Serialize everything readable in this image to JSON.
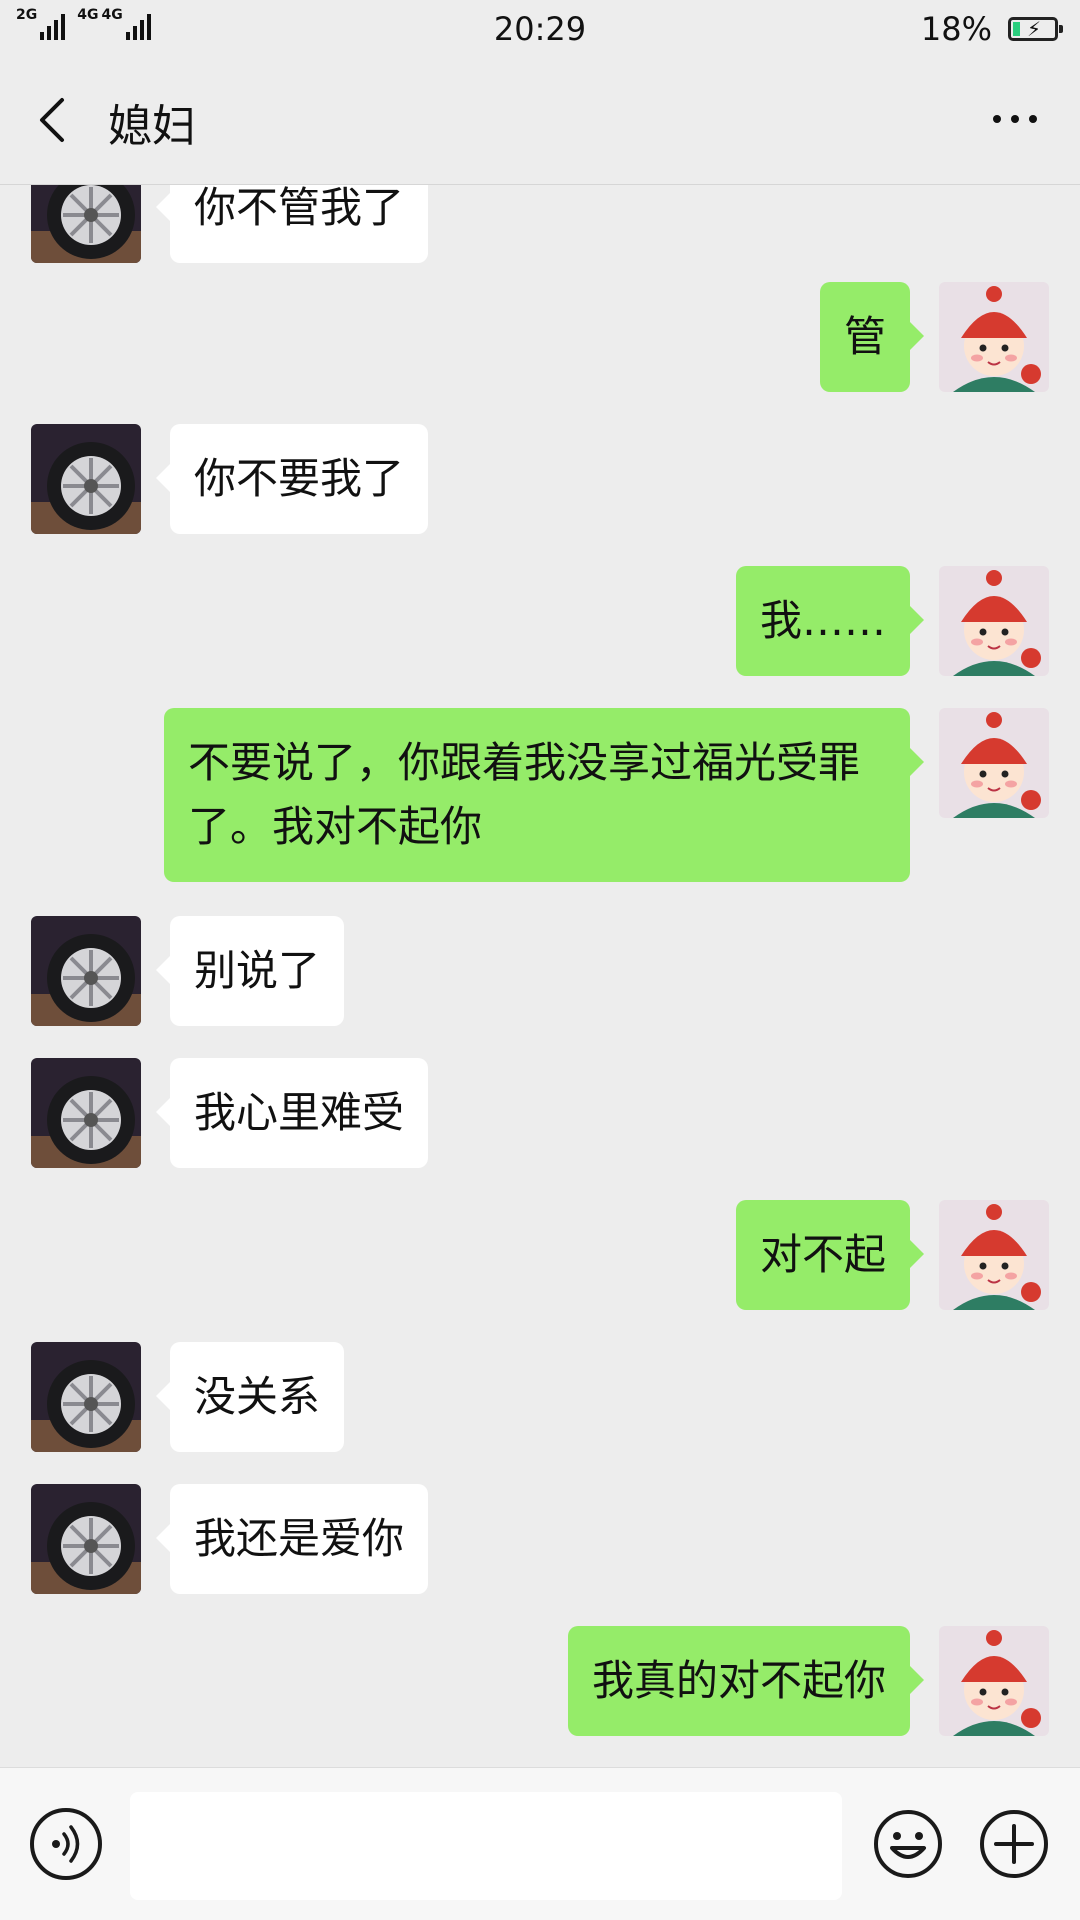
{
  "status_bar": {
    "network_1": "2G",
    "network_2": "4G",
    "network_3": "4G",
    "time": "20:29",
    "battery_percent": "18%",
    "battery_level": 0.18,
    "battery_color": "#2bcf7e"
  },
  "header": {
    "title": "媳妇",
    "back_icon": "chevron-left-icon",
    "more_icon": "more-dots-icon"
  },
  "messages": [
    {
      "side": "left",
      "text": "你不管我了"
    },
    {
      "side": "right",
      "text": "管"
    },
    {
      "side": "left",
      "text": "你不要我了"
    },
    {
      "side": "right",
      "text": "我……"
    },
    {
      "side": "right",
      "text": "不要说了，你跟着我没享过福光受罪了。我对不起你"
    },
    {
      "side": "left",
      "text": "别说了"
    },
    {
      "side": "left",
      "text": "我心里难受"
    },
    {
      "side": "right",
      "text": "对不起"
    },
    {
      "side": "left",
      "text": "没关系"
    },
    {
      "side": "left",
      "text": "我还是爱你"
    },
    {
      "side": "right",
      "text": "我真的对不起你"
    }
  ],
  "input_bar": {
    "value": "",
    "voice_icon": "voice-icon",
    "emoji_icon": "emoji-icon",
    "plus_icon": "plus-icon"
  },
  "colors": {
    "background": "#ededed",
    "outgoing_bubble": "#95ec69",
    "incoming_bubble": "#ffffff"
  }
}
